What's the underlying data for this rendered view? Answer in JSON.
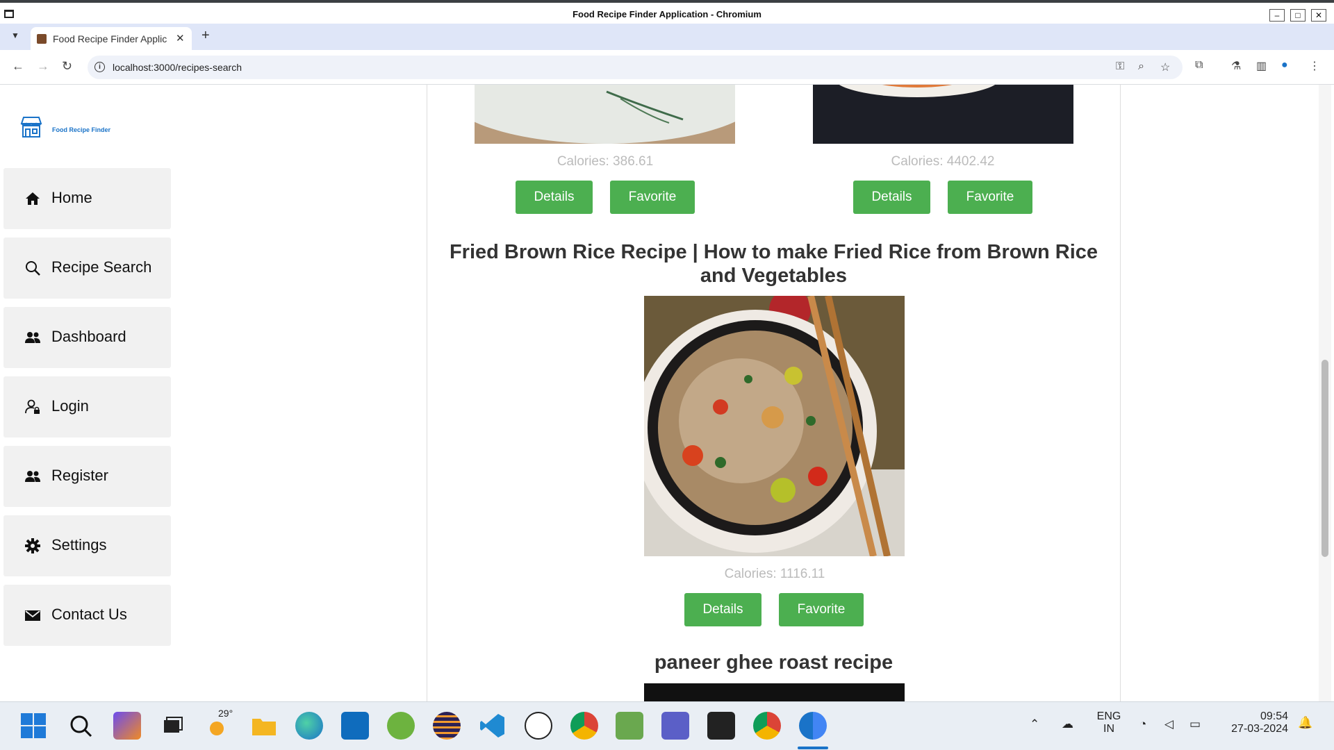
{
  "window": {
    "title": "Food Recipe Finder Application - Chromium"
  },
  "browser": {
    "tab_title": "Food Recipe Finder Applic",
    "tab_close": "✕",
    "new_tab": "+",
    "url": "localhost:3000/recipes-search"
  },
  "sidebar": {
    "logo_text": "Food Recipe Finder",
    "items": [
      {
        "label": "Home",
        "icon": "home-icon"
      },
      {
        "label": "Recipe Search",
        "icon": "search-icon"
      },
      {
        "label": "Dashboard",
        "icon": "users-icon"
      },
      {
        "label": "Login",
        "icon": "user-lock-icon"
      },
      {
        "label": "Register",
        "icon": "users-icon"
      },
      {
        "label": "Settings",
        "icon": "gear-icon"
      },
      {
        "label": "Contact Us",
        "icon": "envelope-icon"
      }
    ]
  },
  "recipes": [
    {
      "calories": "Calories: 386.61",
      "details": "Details",
      "favorite": "Favorite"
    },
    {
      "calories": "Calories: 4402.42",
      "details": "Details",
      "favorite": "Favorite"
    },
    {
      "title": "Fried Brown Rice Recipe | How to make Fried Rice from Brown Rice and Vegetables",
      "calories": "Calories: 1116.11",
      "details": "Details",
      "favorite": "Favorite"
    },
    {
      "title": "paneer ghee roast recipe"
    }
  ],
  "taskbar": {
    "weather": "29°",
    "lang1": "ENG",
    "lang2": "IN",
    "time": "09:54",
    "date": "27-03-2024"
  },
  "colors": {
    "button": "#4caf50",
    "accent": "#1a73c8"
  }
}
